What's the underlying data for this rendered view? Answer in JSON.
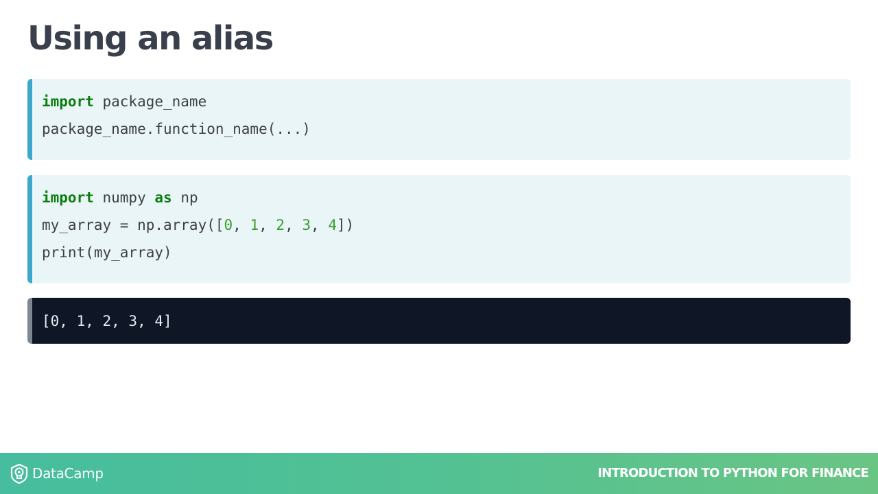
{
  "slide": {
    "title": "Using an alias"
  },
  "code_block_1": {
    "lines": [
      [
        {
          "t": "import",
          "c": "kw"
        },
        {
          "t": " package_name",
          "c": ""
        }
      ],
      [
        {
          "t": "package_name.function_name(...)",
          "c": ""
        }
      ]
    ]
  },
  "code_block_2": {
    "lines": [
      [
        {
          "t": "import",
          "c": "kw"
        },
        {
          "t": " numpy ",
          "c": ""
        },
        {
          "t": "as",
          "c": "kw"
        },
        {
          "t": " np",
          "c": ""
        }
      ],
      [
        {
          "t": "my_array = np.array([",
          "c": ""
        },
        {
          "t": "0",
          "c": "num"
        },
        {
          "t": ", ",
          "c": ""
        },
        {
          "t": "1",
          "c": "num"
        },
        {
          "t": ", ",
          "c": ""
        },
        {
          "t": "2",
          "c": "num"
        },
        {
          "t": ", ",
          "c": ""
        },
        {
          "t": "3",
          "c": "num"
        },
        {
          "t": ", ",
          "c": ""
        },
        {
          "t": "4",
          "c": "num"
        },
        {
          "t": "])",
          "c": ""
        }
      ],
      [
        {
          "t": "print(my_array)",
          "c": ""
        }
      ]
    ]
  },
  "output_block": {
    "text": "[0, 1, 2, 3, 4]"
  },
  "footer": {
    "brand": "DataCamp",
    "logo_icon": "datacamp-shield-icon",
    "course_title": "INTRODUCTION TO PYTHON FOR FINANCE"
  },
  "colors": {
    "keyword": "#0d7d12",
    "number": "#3a9e2a",
    "code_accent": "#3ea8cc",
    "output_bg": "#0f1726",
    "footer_start": "#46bd9e",
    "footer_end": "#6ac584"
  }
}
